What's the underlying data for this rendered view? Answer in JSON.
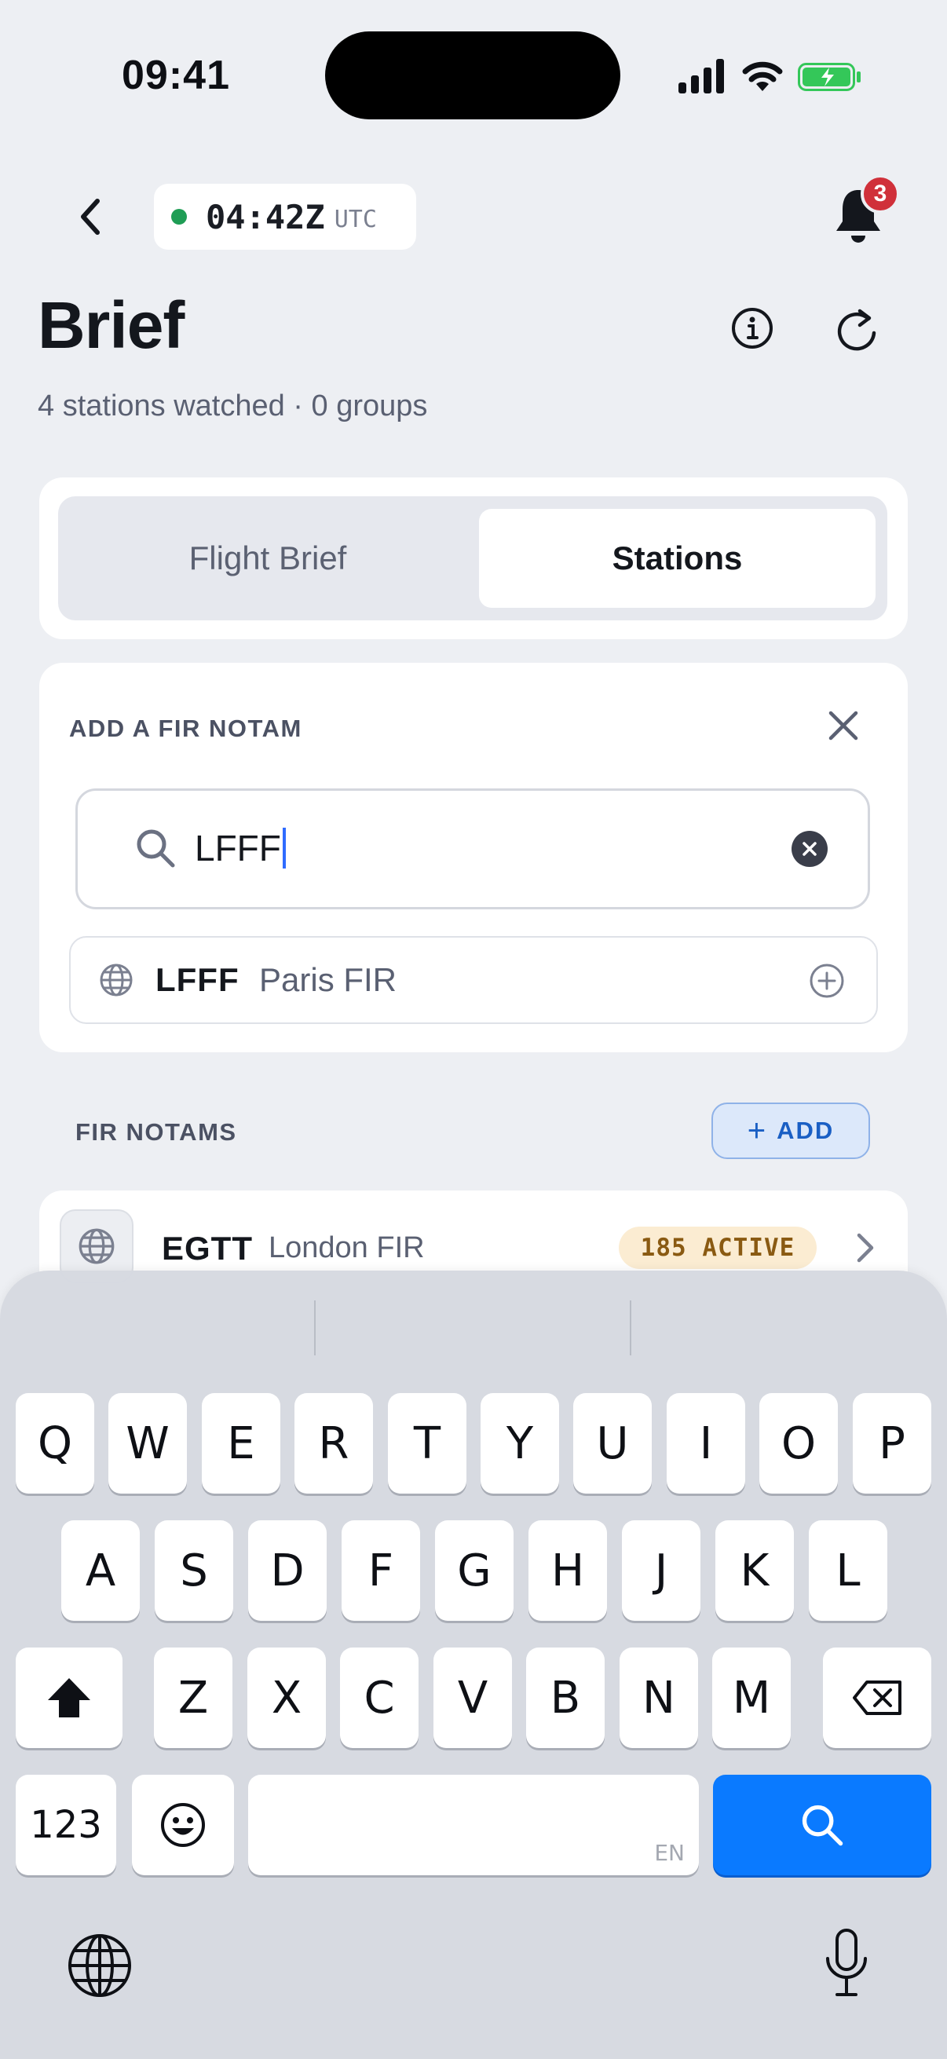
{
  "status_bar": {
    "time": "09:41"
  },
  "header": {
    "utc_time": "04:42Z",
    "utc_label": "UTC",
    "notification_count": "3"
  },
  "page": {
    "title": "Brief",
    "subtitle": "4 stations watched · 0 groups"
  },
  "segments": {
    "flight_brief": "Flight Brief",
    "stations": "Stations",
    "selected": "Stations"
  },
  "add_fir": {
    "title": "ADD A FIR NOTAM",
    "search_value": "LFFF",
    "result": {
      "code": "LFFF",
      "name": "Paris FIR"
    }
  },
  "fir_notams": {
    "title": "FIR NOTAMS",
    "add_label": "ADD",
    "items": [
      {
        "code": "EGTT",
        "name": "London FIR",
        "badge": "185 ACTIVE"
      }
    ]
  },
  "keyboard": {
    "row1": [
      "Q",
      "W",
      "E",
      "R",
      "T",
      "Y",
      "U",
      "I",
      "O",
      "P"
    ],
    "row2": [
      "A",
      "S",
      "D",
      "F",
      "G",
      "H",
      "J",
      "K",
      "L"
    ],
    "row3": [
      "Z",
      "X",
      "C",
      "V",
      "B",
      "N",
      "M"
    ],
    "numbers_label": "123",
    "space_lang": "EN"
  },
  "colors": {
    "accent": "#0a7aff",
    "live": "#1f9d55",
    "badge_bg": "#fbecd2",
    "alert": "#d0303a"
  }
}
